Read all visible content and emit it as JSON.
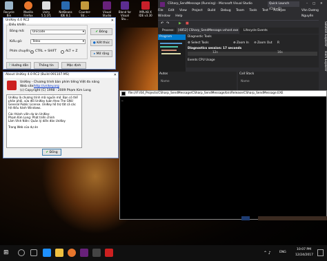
{
  "desktop_icons": [
    {
      "label": "Recycle Bin",
      "color": "#9ab4c8"
    },
    {
      "label": "Mozilla Firefox",
      "color": "#e8762c"
    },
    {
      "label": "Unity 5.5.1f1 (64-bit)",
      "color": "#dddddd"
    },
    {
      "label": "NetBeans IDE 8.1",
      "color": "#2a6ab0"
    },
    {
      "label": "Counter-Str... - Shortcut",
      "color": "#c29a3c"
    },
    {
      "label": "Visual Studio 2015",
      "color": "#68217a"
    },
    {
      "label": "Blend for Visual Stu...",
      "color": "#5c2d91"
    },
    {
      "label": "MPLAB X IDE v3.30",
      "color": "#c8202a"
    }
  ],
  "unikey": {
    "title": "UniKey 4.0 RC2",
    "group_label": "Điều khiển",
    "bang_ma_label": "Bảng mã:",
    "bang_ma_value": "Unicode",
    "kieu_go_label": "Kiểu gõ:",
    "kieu_go_value": "Telex",
    "phim_chuyen_label": "Phím chuyển:",
    "radio1": "CTRL + SHIFT",
    "radio2": "ALT + Z",
    "btn_dong": "Đóng",
    "btn_ket_thuc": "Kết thúc",
    "btn_mo_rong": "Mở rộng",
    "btn_huong_dan": "Hướng dẫn",
    "btn_thong_tin": "Thông tin",
    "btn_mac_dinh": "Mặc định"
  },
  "about": {
    "title": "About UniKey 4.0 RC2 (Build 091107.MS)",
    "line1": "UniKey - Chương trình bàn phím tiếng Việt đa năng",
    "web_label": "Web site:",
    "web_link": "http://unikey.org",
    "copyright": "(c) Copyright (C) 1998 - 2009 Phạm Kim Long",
    "body": [
      "UniKey là chương trình mã nguồn mở. Bạn có thể phân phối, sửa đổi UniKey tuân theo The GNU General Public License. UniKey hỗ trợ tất cả các hệ điều hành Windows.",
      "",
      "Các thành viên dự án UniKey:",
      "   Phạm Kim Long: Phát triển chính",
      "   Lâm Vĩnh Niên: Quản lý diễn đàn UniKey",
      "",
      "Trang Web của dự án"
    ],
    "ok": "Đồng"
  },
  "vs": {
    "title": "CSharp_SendMessage (Running) - Microsoft Visual Studio",
    "quick_launch": "Quick Launch (Ctrl+Q)",
    "menu": [
      "File",
      "Edit",
      "View",
      "Project",
      "Build",
      "Debug",
      "Team",
      "Tools",
      "Test",
      "Analyze",
      "Window",
      "Help"
    ],
    "user": "Văn Dương Nguyễn",
    "process_label": "Process:",
    "process_value": "[4852] CSharp_SendMessage.vshost.exe",
    "lifecycle": "Lifecycle Events",
    "program_tab": "Program",
    "diag_title": "Diagnostic Tools",
    "select_tools": "Select Tools",
    "zoom_in": "Zoom In",
    "zoom_out": "Zoom Out",
    "reset": "R",
    "session": "Diagnostics session: 17 seconds",
    "t1": "12s",
    "t2": "16s",
    "events_tab": "Events",
    "cpu_tab": "CPU Usage",
    "autos": "Autos",
    "call_stack": "Call Stack",
    "name_col": "Name",
    "solution_explorer": "Solution Explorer",
    "team_explorer": "Team Explorer"
  },
  "console": {
    "title": "file:///F:/04_Projects/CSharp_SendMessage/CSharp_SendMessage/bin/Release/CSharp_SendMessage.EXE",
    "cursor": "_"
  },
  "taskbar": {
    "time": "10:07 PM",
    "date": "12/24/2017",
    "lang": "ENG"
  }
}
